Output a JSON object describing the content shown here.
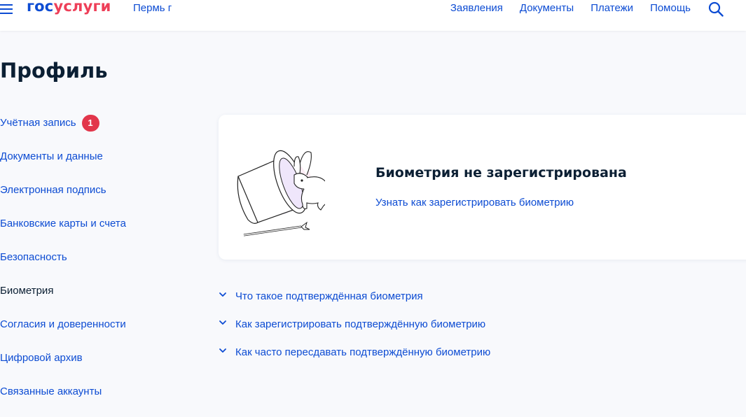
{
  "header": {
    "logo": {
      "part1": "гос",
      "part2": "услуги"
    },
    "city": "Пермь г",
    "nav": [
      "Заявления",
      "Документы",
      "Платежи",
      "Помощь"
    ],
    "icons": {
      "menu": "burger-icon",
      "search": "search-icon"
    }
  },
  "page": {
    "title": "Профиль"
  },
  "sidebar": {
    "items": [
      {
        "label": "Учётная запись",
        "badge": "1"
      },
      {
        "label": "Документы и данные"
      },
      {
        "label": "Электронная подпись"
      },
      {
        "label": "Банковские карты и счета"
      },
      {
        "label": "Безопасность"
      },
      {
        "label": "Биометрия",
        "active": true
      },
      {
        "label": "Согласия и доверенности"
      },
      {
        "label": "Цифровой архив"
      },
      {
        "label": "Связанные аккаунты"
      }
    ]
  },
  "card": {
    "title": "Биометрия не зарегистрирована",
    "link": "Узнать как зарегистрировать биометрию",
    "illustration": "magic-hat-rabbit-illustration"
  },
  "faq": {
    "items": [
      "Что такое подтверждённая биометрия",
      "Как зарегистрировать подтверждённую биометрию",
      "Как часто пересдавать подтверждённую биометрию"
    ]
  },
  "colors": {
    "brand_blue": "#0d4cd3",
    "brand_red": "#ee3f58",
    "badge_red": "#e2364b",
    "text_dark": "#0b1f33",
    "background": "#f8f9fc",
    "card_bg": "#ffffff"
  }
}
